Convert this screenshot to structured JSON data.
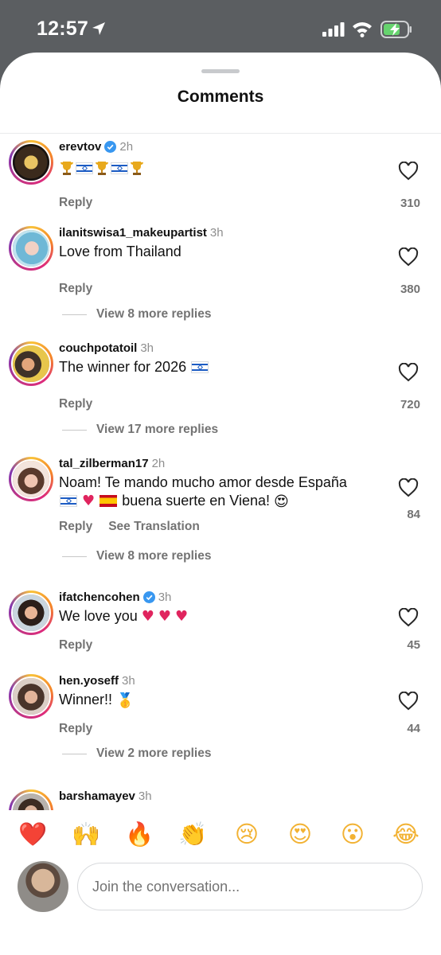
{
  "status": {
    "time": "12:57"
  },
  "sheet": {
    "title": "Comments"
  },
  "comments": [
    {
      "username": "erevtov",
      "verified": true,
      "age": "2h",
      "text": "🏆🇮🇱🏆🇮🇱🏆",
      "reply": "Reply",
      "likes": "310"
    },
    {
      "username": "ilanitswisa1_makeupartist",
      "verified": false,
      "age": "3h",
      "text": "Love from Thailand",
      "reply": "Reply",
      "likes": "380",
      "more_replies": "View 8 more replies"
    },
    {
      "username": "couchpotatoil",
      "verified": false,
      "age": "3h",
      "text": "The winner for 2026",
      "reply": "Reply",
      "likes": "720",
      "more_replies": "View 17 more replies"
    },
    {
      "username": "tal_zilberman17",
      "verified": false,
      "age": "2h",
      "text_line1": "Noam! Te mando mucho amor desde España",
      "text_line2": "buena suerte en Viena!",
      "reply": "Reply",
      "translate": "See Translation",
      "likes": "84",
      "more_replies": "View 8 more replies"
    },
    {
      "username": "ifatchencohen",
      "verified": true,
      "age": "3h",
      "text": "We love you",
      "reply": "Reply",
      "likes": "45"
    },
    {
      "username": "hen.yoseff",
      "verified": false,
      "age": "3h",
      "text": "Winner!!",
      "reply": "Reply",
      "likes": "44",
      "more_replies": "View 2 more replies"
    },
    {
      "username": "barshamayev",
      "verified": false,
      "age": "3h"
    }
  ],
  "reactions": [
    "❤️",
    "🙌",
    "🔥",
    "👏",
    "😢",
    "😍",
    "😮",
    "😂"
  ],
  "composer": {
    "placeholder": "Join the conversation..."
  },
  "colors": {
    "accent_blue": "#3897f0",
    "heart_red": "#e0245e",
    "ring_gradient": [
      "#f9c33a",
      "#dd2a7b",
      "#8134af"
    ]
  },
  "icons": [
    "location-arrow-icon",
    "signal-icon",
    "wifi-icon",
    "battery-charging-icon",
    "heart-outline-icon",
    "verified-badge-icon"
  ]
}
